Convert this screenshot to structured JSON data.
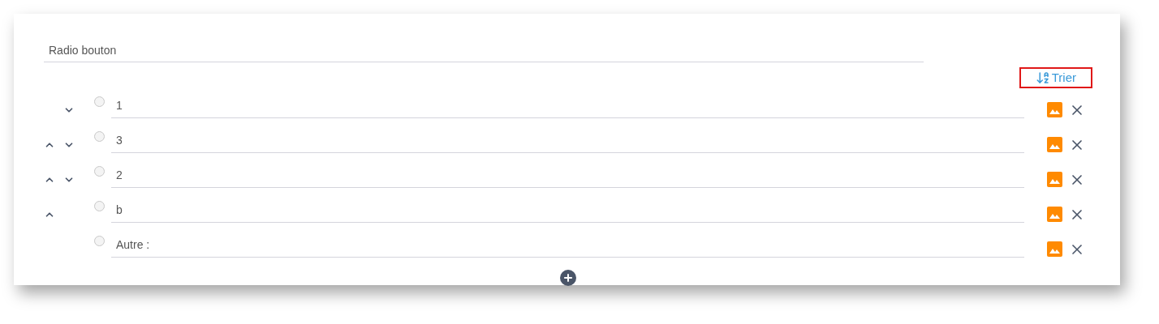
{
  "question": {
    "value": "Radio bouton"
  },
  "sort_button": {
    "label": "Trier",
    "highlighted": true
  },
  "options": [
    {
      "value": "1",
      "selected": false,
      "move_up": false,
      "move_down": true
    },
    {
      "value": "3",
      "selected": false,
      "move_up": true,
      "move_down": true
    },
    {
      "value": "2",
      "selected": false,
      "move_up": true,
      "move_down": true
    },
    {
      "value": "b",
      "selected": false,
      "move_up": true,
      "move_down": false
    },
    {
      "value": "Autre :",
      "selected": false,
      "move_up": false,
      "move_down": false
    }
  ]
}
